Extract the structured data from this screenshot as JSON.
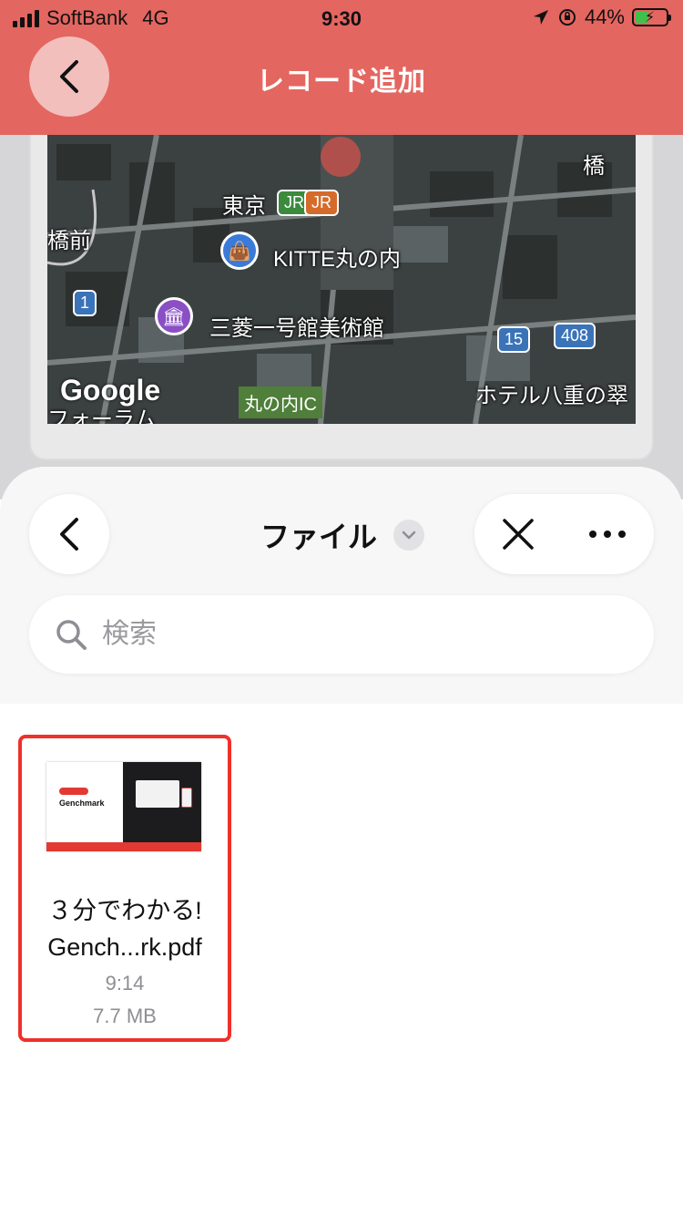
{
  "status_bar": {
    "carrier": "SoftBank",
    "network": "4G",
    "time": "9:30",
    "battery": "44%",
    "battery_level": 0.44
  },
  "nav": {
    "title": "レコード追加",
    "back_icon": "chevron-left-icon"
  },
  "map": {
    "labels": [
      "東京",
      "KITTE丸の内",
      "三菱一号館美術館",
      "橋前",
      "ホテル八重の翠",
      "フォーラム",
      "橋"
    ],
    "ic_label": "丸の内IC",
    "attribution": "Google",
    "route_badges": [
      "1",
      "15",
      "408"
    ],
    "rail_badges": [
      "JR",
      "JR"
    ]
  },
  "sheet": {
    "title": "ファイル",
    "search": {
      "placeholder": "検索"
    },
    "icons": {
      "back": "chevron-left-icon",
      "dropdown": "chevron-down-icon",
      "close": "close-icon",
      "more": "more-icon",
      "search": "search-icon"
    }
  },
  "files": [
    {
      "name_line1": "３分でわかる!",
      "name_line2": "Gench...rk.pdf",
      "time": "9:14",
      "size": "7.7 MB",
      "thumb_brand": "Genchmark"
    }
  ],
  "colors": {
    "accent": "#e46660",
    "selection": "#f0302a"
  }
}
